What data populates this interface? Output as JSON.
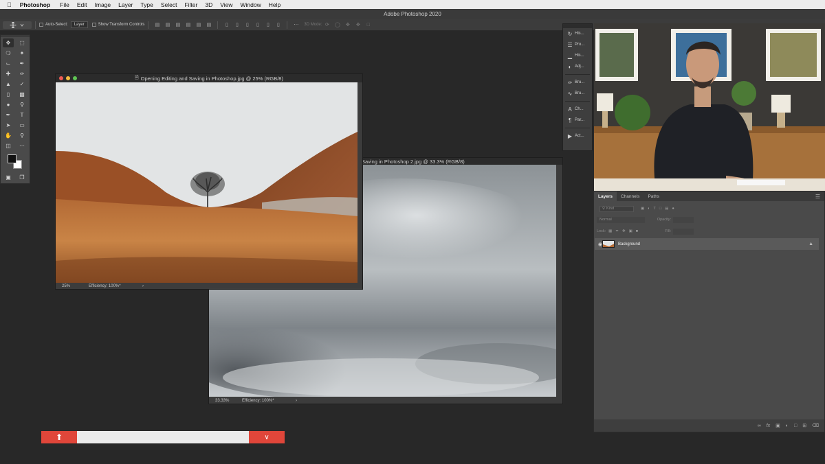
{
  "menubar": {
    "apple": "",
    "app": "Photoshop",
    "items": [
      "File",
      "Edit",
      "Image",
      "Layer",
      "Type",
      "Select",
      "Filter",
      "3D",
      "View",
      "Window",
      "Help"
    ]
  },
  "window_title": "Adobe Photoshop 2020",
  "options": {
    "auto_select_label": "Auto-Select:",
    "auto_select_value": "Layer",
    "transform_label": "Show Transform Controls",
    "mode_3d": "3D Mode:"
  },
  "doc1": {
    "title": "Opening Editing and Saving in Photoshop.jpg @ 25% (RGB/8)",
    "zoom": "25%",
    "efficiency": "Efficiency: 100%*",
    "arrow": "›"
  },
  "doc2": {
    "title": "Saving in Photoshop 2.jpg @ 33.3% (RGB/8)",
    "zoom": "33.33%",
    "efficiency": "Efficiency: 100%*",
    "arrow": "›"
  },
  "right_panels": [
    {
      "label": "His...",
      "icon": "history-icon"
    },
    {
      "label": "Pro...",
      "icon": "properties-icon"
    },
    {
      "label": "His...",
      "icon": "histogram-icon"
    },
    {
      "label": "Adj...",
      "icon": "adjustments-icon"
    },
    {
      "label": "Bru...",
      "icon": "brush-icon"
    },
    {
      "label": "Bru...",
      "icon": "brush-settings-icon"
    },
    {
      "label": "Ch...",
      "icon": "character-icon"
    },
    {
      "label": "Par...",
      "icon": "paragraph-icon"
    },
    {
      "label": "Act...",
      "icon": "actions-icon"
    }
  ],
  "layers_panel": {
    "tabs": [
      "Layers",
      "Channels",
      "Paths"
    ],
    "kind_placeholder": "Kind",
    "blend_mode": "Normal",
    "opacity_label": "Opacity:",
    "lock_label": "Lock:",
    "fill_label": "Fill:",
    "layer_name": "Background"
  },
  "colors": {
    "accent_red": "#e0463a",
    "workspace": "#282828",
    "panel": "#4a4a4a"
  }
}
